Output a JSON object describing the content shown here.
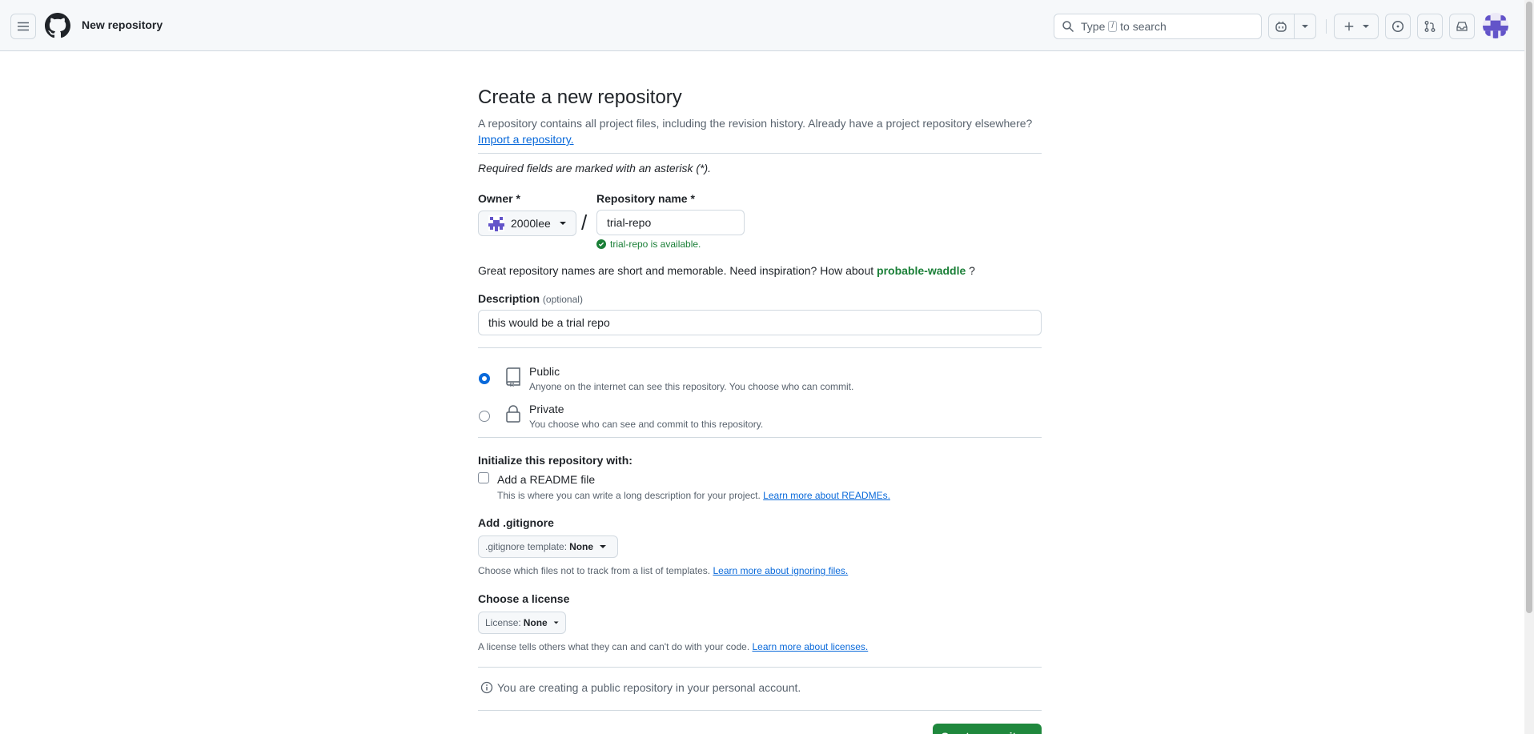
{
  "header": {
    "title": "New repository",
    "search": {
      "prefix": "Type",
      "key": "/",
      "suffix": "to search"
    }
  },
  "page": {
    "heading": "Create a new repository",
    "subtitle": "A repository contains all project files, including the revision history. Already have a project repository elsewhere?",
    "import_link": "Import a repository.",
    "required_note": "Required fields are marked with an asterisk (*)."
  },
  "owner": {
    "label": "Owner *",
    "value": "2000lee"
  },
  "repo_name": {
    "label": "Repository name *",
    "value": "trial-repo",
    "availability": "trial-repo is available."
  },
  "inspiration": {
    "text": "Great repository names are short and memorable. Need inspiration? How about",
    "suggestion": "probable-waddle",
    "end": "?"
  },
  "description": {
    "label": "Description",
    "optional": "(optional)",
    "value": "this would be a trial repo"
  },
  "visibility": {
    "selected": "Public",
    "public": {
      "title": "Public",
      "desc": "Anyone on the internet can see this repository. You choose who can commit."
    },
    "private": {
      "title": "Private",
      "desc": "You choose who can see and commit to this repository."
    }
  },
  "initialize": {
    "label": "Initialize this repository with:",
    "readme": {
      "label": "Add a README file",
      "checked": false,
      "desc": "This is where you can write a long description for your project.",
      "link": "Learn more about READMEs."
    }
  },
  "gitignore": {
    "label": "Add .gitignore",
    "select_key": ".gitignore template:",
    "select_value": "None",
    "desc": "Choose which files not to track from a list of templates.",
    "link": "Learn more about ignoring files."
  },
  "license": {
    "label": "Choose a license",
    "select_key": "License:",
    "select_value": "None",
    "desc": "A license tells others what they can and can't do with your code.",
    "link": "Learn more about licenses."
  },
  "notice": "You are creating a public repository in your personal account.",
  "create_button": "Create repository",
  "colors": {
    "primary_button": "#1f883d",
    "link": "#0969da",
    "success": "#1a7f37"
  }
}
